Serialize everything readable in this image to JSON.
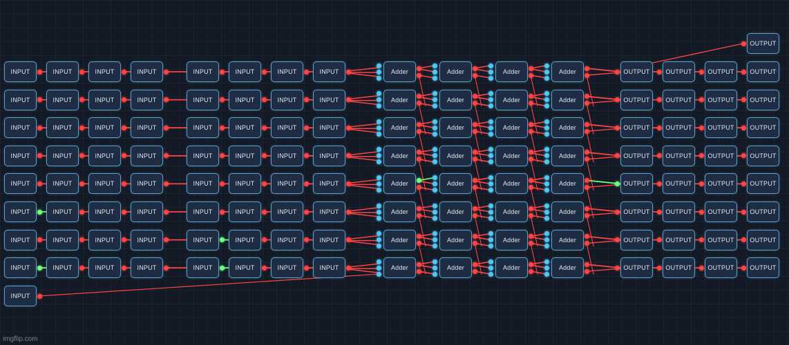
{
  "labels": {
    "input": "INPUT",
    "adder": "Adder",
    "output": "OUTPUT"
  },
  "extra_output_label": "OUTPUT",
  "extra_input_label": "INPUT",
  "rows": 8,
  "input_nodes_per_row": 8,
  "adders_per_row": 4,
  "output_nodes_per_row": 4,
  "colors": {
    "background": "#131a26",
    "node_fill": "#1f2d44",
    "node_border": "#5fa0c8",
    "wire_off": "#ff4444",
    "wire_on": "#6fff7a",
    "adder_pin": "#50c8f5"
  },
  "active_row_outputs": [
    4
  ],
  "watermark": "imgflip.com"
}
